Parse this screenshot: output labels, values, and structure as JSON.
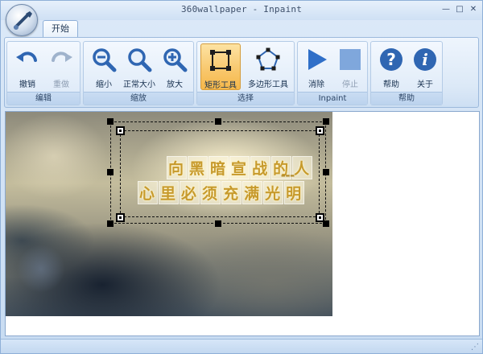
{
  "window": {
    "title": "360wallpaper - Inpaint",
    "controls": {
      "minimize": "—",
      "restore": "□",
      "close": "✕"
    }
  },
  "ribbon": {
    "tabs": [
      {
        "label": "开始",
        "active": true
      }
    ],
    "groups": [
      {
        "label": "编辑",
        "buttons": [
          {
            "label": "撤销",
            "icon": "undo-icon",
            "enabled": true
          },
          {
            "label": "重做",
            "icon": "redo-icon",
            "enabled": false
          }
        ]
      },
      {
        "label": "缩放",
        "buttons": [
          {
            "label": "缩小",
            "icon": "zoom-out-icon"
          },
          {
            "label": "正常大小",
            "icon": "zoom-normal-icon"
          },
          {
            "label": "放大",
            "icon": "zoom-in-icon"
          }
        ]
      },
      {
        "label": "选择",
        "buttons": [
          {
            "label": "矩形工具",
            "icon": "rectangle-tool-icon",
            "active": true
          },
          {
            "label": "多边形工具",
            "icon": "polygon-tool-icon"
          }
        ]
      },
      {
        "label": "Inpaint",
        "buttons": [
          {
            "label": "消除",
            "icon": "play-icon",
            "enabled": true
          },
          {
            "label": "停止",
            "icon": "stop-icon",
            "enabled": false
          }
        ]
      },
      {
        "label": "帮助",
        "buttons": [
          {
            "label": "帮助",
            "icon": "help-icon"
          },
          {
            "label": "关于",
            "icon": "info-icon"
          }
        ]
      }
    ]
  },
  "image": {
    "line1": "向黑暗宣战的人",
    "line2": "心里必须充满光明"
  },
  "colors": {
    "accent": "#2b6cc4",
    "active_tool": "#f8c66a",
    "text_gold": "#c79a2c"
  }
}
